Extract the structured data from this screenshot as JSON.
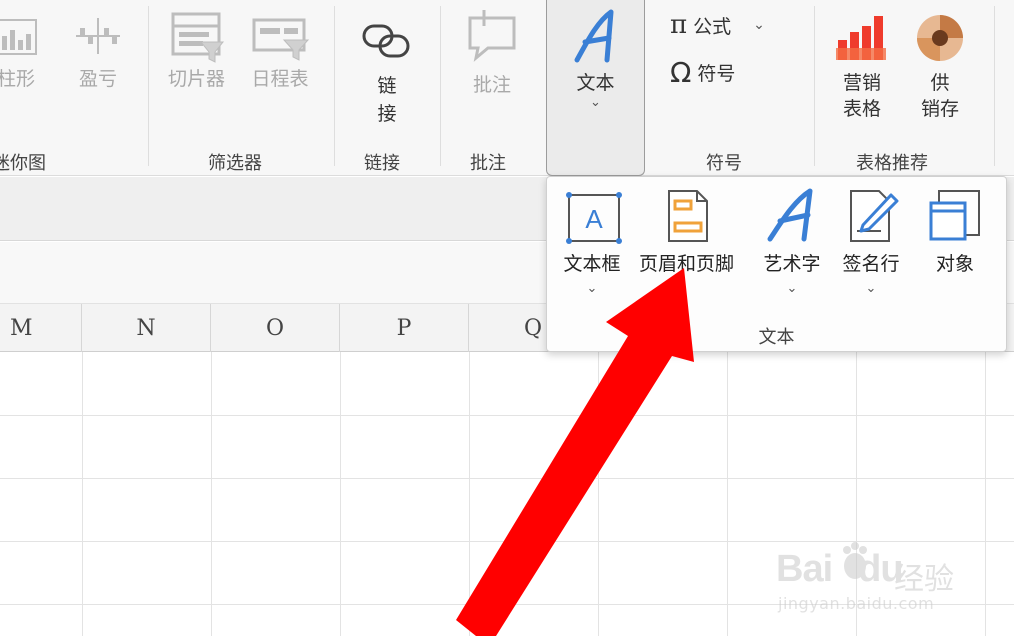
{
  "ribbon": {
    "sparklines": {
      "buttons": [
        {
          "label": "柱形",
          "icon": "column-sparkline-icon"
        },
        {
          "label": "盈亏",
          "icon": "winloss-sparkline-icon"
        }
      ],
      "group_label": "迷你图"
    },
    "filters": {
      "buttons": [
        {
          "label": "切片器",
          "icon": "slicer-icon"
        },
        {
          "label": "日程表",
          "icon": "timeline-icon"
        }
      ],
      "group_label": "筛选器"
    },
    "links": {
      "button_label": "链接",
      "button_chars": [
        "链",
        "接"
      ],
      "group_label": "链接"
    },
    "comments": {
      "button_label": "批注",
      "group_label": "批注"
    },
    "text": {
      "button_label": "文本",
      "chevron": "⌄"
    },
    "symbols": {
      "formula_label": "公式",
      "formula_icon": "π",
      "symbol_label": "符号",
      "symbol_icon": "Ω",
      "chevron": "⌄",
      "group_label": "符号"
    },
    "table_recommend": {
      "buttons": [
        {
          "label": "营销表格",
          "line1": "营销",
          "line2": "表格",
          "icon": "marketing-table-icon"
        },
        {
          "label": "供销存",
          "line1": "供",
          "line2": "销存",
          "icon": "inventory-icon"
        }
      ],
      "group_label": "表格推荐"
    }
  },
  "dropdown": {
    "items": [
      {
        "label": "文本框",
        "icon": "textbox-icon",
        "has_chevron": true
      },
      {
        "label": "页眉和页脚",
        "icon": "header-footer-icon",
        "has_chevron": false
      },
      {
        "label": "艺术字",
        "icon": "wordart-icon",
        "has_chevron": true
      },
      {
        "label": "签名行",
        "icon": "signature-line-icon",
        "has_chevron": true
      },
      {
        "label": "对象",
        "icon": "object-icon",
        "has_chevron": false
      }
    ],
    "chevron": "⌄",
    "group_label": "文本"
  },
  "grid": {
    "columns": [
      "M",
      "N",
      "O",
      "P",
      "Q"
    ]
  },
  "watermark": {
    "brand": "Bai",
    "brand_tail": "du",
    "brand_cn": "经验",
    "url": "jingyan.baidu.com"
  },
  "colors": {
    "accent_blue": "#3a7fd5",
    "orange": "#f0a23a",
    "arrow_red": "#ff0000",
    "dim_gray": "#a9a9a9"
  }
}
